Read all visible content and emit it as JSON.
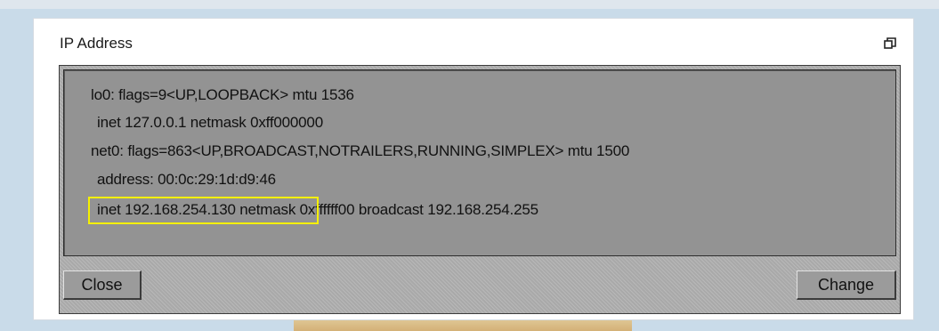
{
  "dialog": {
    "title": "IP Address",
    "restore_icon": "restore-window-icon"
  },
  "output": {
    "lines": [
      "lo0: flags=9<UP,LOOPBACK> mtu 1536",
      "inet 127.0.0.1 netmask 0xff000000",
      "net0: flags=863<UP,BROADCAST,NOTRAILERS,RUNNING,SIMPLEX> mtu 1500",
      "address: 00:0c:29:1d:d9:46",
      "inet 192.168.254.130 netmask 0xffffff00 broadcast 192.168.254.255"
    ],
    "highlight_color": "#f5f000"
  },
  "buttons": {
    "close_label": "Close",
    "change_label": "Change"
  }
}
